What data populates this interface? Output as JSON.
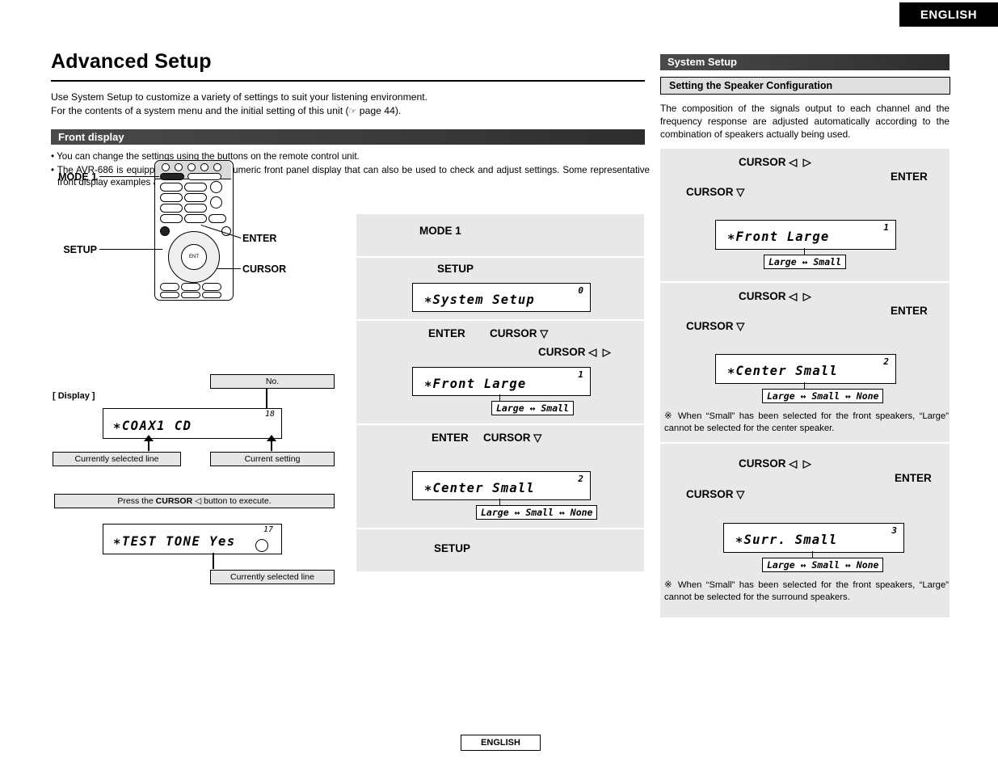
{
  "page": {
    "language_tag_top": "ENGLISH",
    "language_tag_bottom": "ENGLISH",
    "title": "Advanced Setup",
    "intro_line1": "Use System Setup to customize a variety of settings to suit your listening environment.",
    "intro_line2_a": "For the contents of a system menu and the initial setting of this unit (",
    "intro_line2_ref": "page 44).",
    "ref_icon": "pointing-hand-icon"
  },
  "front_display": {
    "section_title": "Front display",
    "bullet1": "You can change the settings using the buttons on the remote control unit.",
    "bullet2": "The AVR-686 is equipped with an alpha numeric front panel display that can also be used to check and adjust settings. Some representative front display examples are shown below."
  },
  "remote": {
    "label_mode1": "MODE 1",
    "label_setup": "SETUP",
    "label_enter": "ENTER",
    "label_cursor": "CURSOR"
  },
  "legend": {
    "no_label": "No.",
    "display_label": "[ Display ]",
    "display_number": "18",
    "display_text": "∗COAX1   CD",
    "currently_selected_line": "Currently selected line",
    "current_setting": "Current setting",
    "press_cursor_pre": "Press the ",
    "press_cursor_bold": "CURSOR",
    "press_cursor_post": " button to execute.",
    "test_tone_number": "17",
    "test_tone_text": "∗TEST TONE Yes",
    "currently_selected_line2": "Currently selected line"
  },
  "flow": {
    "step1_label": "MODE 1",
    "step2_label": "SETUP",
    "step2_display_text": "∗System Setup",
    "step2_display_num": "0",
    "step3_label_enter": "ENTER",
    "step3_label_cursor_down": "CURSOR",
    "step3_label_cursor_lr": "CURSOR",
    "step3_display_text": "∗Front    Large",
    "step3_display_num": "1",
    "step3_options": "Large ↔ Small",
    "step4_label_enter": "ENTER",
    "step4_label_cursor_down": "CURSOR",
    "step4_display_text": "∗Center   Small",
    "step4_display_num": "2",
    "step4_options": "Large ↔ Small ↔ None",
    "step5_label": "SETUP"
  },
  "system_setup": {
    "bar_title": "System Setup",
    "sub_title": "Setting the Speaker Configuration",
    "description": "The composition of the signals output to each channel and the frequency response are adjusted automatically according to the combination of speakers actually being used.",
    "panels": [
      {
        "cursor_lr_label": "CURSOR",
        "cursor_down_label": "CURSOR",
        "enter_label": "ENTER",
        "display_text": "∗Front    Large",
        "display_num": "1",
        "options": "Large ↔ Small",
        "note": ""
      },
      {
        "cursor_lr_label": "CURSOR",
        "cursor_down_label": "CURSOR",
        "enter_label": "ENTER",
        "display_text": "∗Center   Small",
        "display_num": "2",
        "options": "Large ↔ Small ↔ None",
        "note": "※ When “Small” has been selected for the front speakers, “Large” cannot be selected for the center speaker."
      },
      {
        "cursor_lr_label": "CURSOR",
        "cursor_down_label": "CURSOR",
        "enter_label": "ENTER",
        "display_text": "∗Surr.    Small",
        "display_num": "3",
        "options": "Large ↔ Small ↔ None",
        "note": "※ When “Small” has been selected for the front speakers, “Large” cannot be selected for the surround speakers."
      }
    ]
  },
  "glyphs": {
    "cursor_left": "◁",
    "cursor_right": "▷",
    "cursor_down": "▽"
  }
}
